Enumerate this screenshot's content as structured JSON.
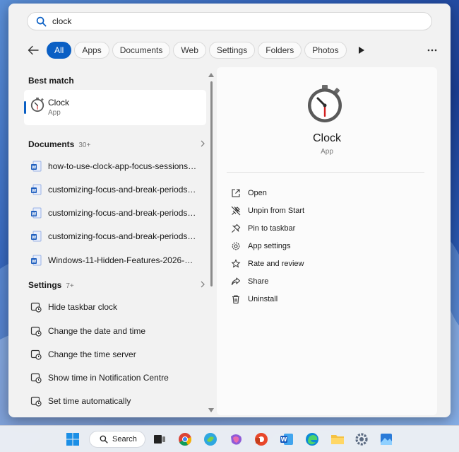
{
  "search": {
    "value": "clock"
  },
  "filters": {
    "back_icon": "back-arrow-icon",
    "chips": [
      "All",
      "Apps",
      "Documents",
      "Web",
      "Settings",
      "Folders",
      "Photos"
    ],
    "active": "All",
    "more_icon": "more-icon"
  },
  "best_match": {
    "title": "Best match",
    "app": {
      "name": "Clock",
      "type": "App",
      "icon": "clock-app-icon"
    }
  },
  "documents": {
    "title": "Documents",
    "count": "30+",
    "items": [
      "how-to-use-clock-app-focus-sessions-s...",
      "customizing-focus-and-break-periods-c...",
      "customizing-focus-and-break-periods-c...",
      "customizing-focus-and-break-periods-c...",
      "Windows-11-Hidden-Features-2026-Kar..."
    ]
  },
  "settings": {
    "title": "Settings",
    "count": "7+",
    "items": [
      "Hide taskbar clock",
      "Change the date and time",
      "Change the time server",
      "Show time in Notification Centre",
      "Set time automatically"
    ]
  },
  "detail": {
    "name": "Clock",
    "type": "App",
    "actions": [
      {
        "label": "Open",
        "icon": "open-icon"
      },
      {
        "label": "Unpin from Start",
        "icon": "unpin-icon"
      },
      {
        "label": "Pin to taskbar",
        "icon": "pin-icon"
      },
      {
        "label": "App settings",
        "icon": "gear-icon"
      },
      {
        "label": "Rate and review",
        "icon": "rate-icon"
      },
      {
        "label": "Share",
        "icon": "share-icon"
      },
      {
        "label": "Uninstall",
        "icon": "trash-icon"
      }
    ]
  },
  "taskbar": {
    "search_label": "Search",
    "icons": [
      "windows-start-icon",
      "task-view-icon",
      "chrome-icon",
      "copilot-icon",
      "teams-icon",
      "office-icon",
      "word-icon",
      "edge-icon",
      "file-explorer-icon",
      "settings-icon",
      "photos-icon"
    ]
  },
  "colors": {
    "accent": "#0a5fc4",
    "panel": "#f2f2f2",
    "detail_panel": "#fbfbfb"
  }
}
